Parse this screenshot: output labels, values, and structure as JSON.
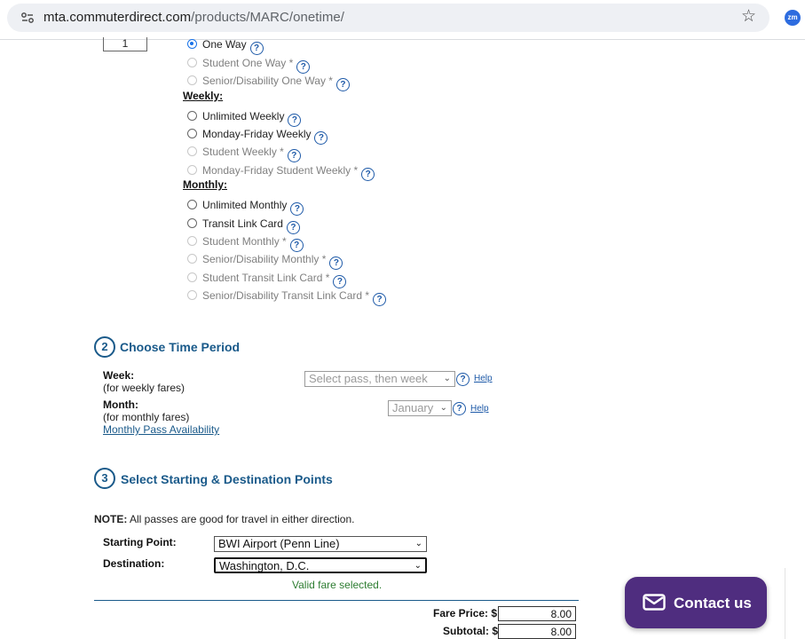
{
  "browser": {
    "url_host": "mta.commuterdirect.com",
    "url_path": "/products/MARC/onetime/",
    "extension_label": "zm"
  },
  "quantity": "1",
  "pass_types": {
    "one_way": [
      {
        "label": "One Way",
        "selected": true,
        "disabled": false
      },
      {
        "label": "Student One Way *",
        "selected": false,
        "disabled": true
      },
      {
        "label": "Senior/Disability One Way *",
        "selected": false,
        "disabled": true
      }
    ],
    "weekly_heading": "Weekly:",
    "weekly": [
      {
        "label": "Unlimited Weekly",
        "disabled": false
      },
      {
        "label": "Monday-Friday Weekly",
        "disabled": false
      },
      {
        "label": "Student Weekly *",
        "disabled": true
      },
      {
        "label": "Monday-Friday Student Weekly *",
        "disabled": true
      }
    ],
    "monthly_heading": "Monthly:",
    "monthly": [
      {
        "label": "Unlimited Monthly",
        "disabled": false
      },
      {
        "label": "Transit Link Card",
        "disabled": false
      },
      {
        "label": "Student Monthly *",
        "disabled": true
      },
      {
        "label": "Senior/Disability Monthly *",
        "disabled": true
      },
      {
        "label": "Student Transit Link Card *",
        "disabled": true
      },
      {
        "label": "Senior/Disability Transit Link Card *",
        "disabled": true
      }
    ],
    "help_glyph": "?"
  },
  "step2": {
    "number": "2",
    "title": "Choose Time Period",
    "week_label": "Week:",
    "week_note": "(for weekly fares)",
    "week_select": "Select pass, then week",
    "month_label": "Month:",
    "month_note": "(for monthly fares)",
    "month_select": "January",
    "availability_link": "Monthly Pass Availability",
    "help_link": "Help"
  },
  "step3": {
    "number": "3",
    "title": "Select Starting & Destination Points",
    "note_label": "NOTE:",
    "note_text": " All passes are good for travel in either direction.",
    "start_label": "Starting Point:",
    "start_value": "BWI Airport (Penn Line)",
    "dest_label": "Destination:",
    "dest_value": "Washington, D.C.",
    "valid_msg": "Valid fare selected."
  },
  "pricing": {
    "fare_label": "Fare Price: $",
    "fare_value": "8.00",
    "subtotal_label": "Subtotal: $",
    "subtotal_value": "8.00"
  },
  "contact": {
    "label": "Contact us"
  }
}
